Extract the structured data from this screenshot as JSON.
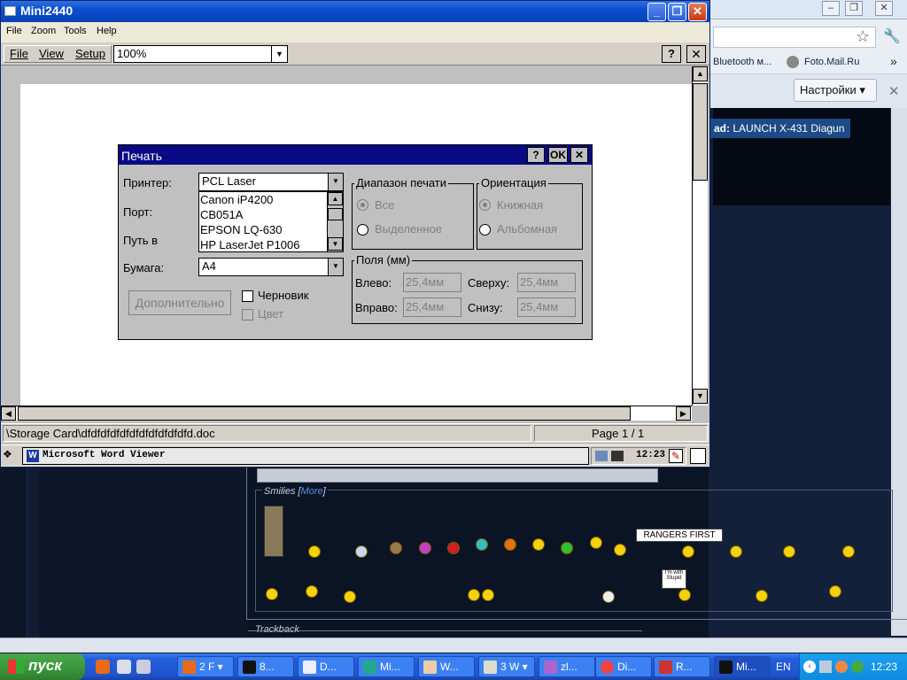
{
  "browser": {
    "bookmarks": [
      "Bluetooth м...",
      "Foto.Mail.Ru"
    ],
    "settings_label": "Настройки",
    "notice_prefix": "ad:",
    "notice_text": "LAUNCH X-431 Diagun"
  },
  "forum": {
    "smilies_label": "Smilies [",
    "smilies_more": "More",
    "smilies_close": "]",
    "sign_text": "RANGERS FIRST",
    "sign2_text": "I'm with Stupid",
    "trackback_label": "Trackback"
  },
  "mini": {
    "title": "Mini2440",
    "menu": [
      "File",
      "Zoom",
      "Tools",
      "Help"
    ]
  },
  "viewer": {
    "menu": [
      "File",
      "View",
      "Setup"
    ],
    "zoom_value": "100%",
    "help_label": "?",
    "close_label": "✕",
    "status_path": "\\Storage Card\\dfdfdfdfdfdfdfdfdfdfdfd.doc",
    "status_page": "Page 1 / 1",
    "task_label": "Microsoft Word Viewer",
    "task_icon": "W",
    "clock": "12:23"
  },
  "print_dialog": {
    "title": "Печать",
    "help": "?",
    "ok": "OK",
    "close": "✕",
    "printer_label": "Принтер:",
    "printer_value": "PCL Laser",
    "printer_options": [
      "Canon iP4200",
      "CB051A",
      "EPSON LQ-630",
      "HP LaserJet P1006"
    ],
    "port_label": "Порт:",
    "path_label": "Путь в",
    "paper_label": "Бумага:",
    "paper_value": "A4",
    "range_group": "Диапазон печати",
    "range_all": "Все",
    "range_selection": "Выделенное",
    "orient_group": "Ориентация",
    "orient_portrait": "Книжная",
    "orient_landscape": "Альбомная",
    "margins_group": "Поля (мм)",
    "left_label": "Влево:",
    "left_value": "25,4мм",
    "right_label": "Вправо:",
    "right_value": "25,4мм",
    "top_label": "Сверху:",
    "top_value": "25,4мм",
    "bottom_label": "Снизу:",
    "bottom_value": "25,4мм",
    "advanced_button": "Дополнительно",
    "draft_label": "Черновик",
    "color_label": "Цвет"
  },
  "xp_taskbar": {
    "start": "пуск",
    "buttons": [
      {
        "label": "2 F",
        "icon": "firefox-icon"
      },
      {
        "label": "8...",
        "icon": "cmd-icon"
      },
      {
        "label": "D...",
        "icon": "document-icon"
      },
      {
        "label": "Mi...",
        "icon": "app-icon"
      },
      {
        "label": "W...",
        "icon": "folder-icon"
      },
      {
        "label": "3 W",
        "icon": "window-icon"
      },
      {
        "label": "zl...",
        "icon": "archive-icon"
      },
      {
        "label": "Di...",
        "icon": "chrome-icon"
      },
      {
        "label": "R...",
        "icon": "app-icon"
      },
      {
        "label": "Mi...",
        "icon": "app-icon"
      }
    ],
    "lang": "EN",
    "clock": "12:23"
  },
  "colors": {
    "xp_blue": "#245edb",
    "ce_dialog_title": "#0a0a84",
    "start_green": "#3c9a3c"
  }
}
